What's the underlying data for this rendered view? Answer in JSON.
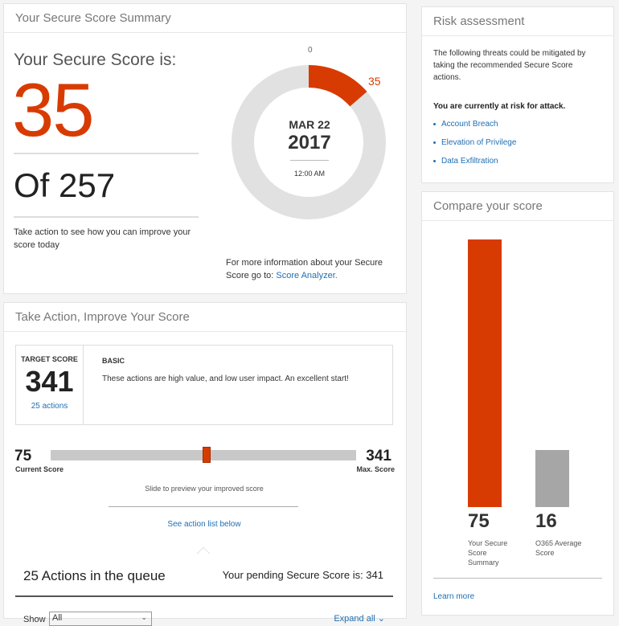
{
  "summary": {
    "title": "Your Secure Score Summary",
    "heading": "Your Secure Score is:",
    "score": "35",
    "of_text": "Of 257",
    "improve_text": "Take action to see how you can improve your score today",
    "donut": {
      "start_label": "0",
      "value_label": "35",
      "value": 35,
      "max": 257,
      "date": "MAR 22",
      "year": "2017",
      "time": "12:00 AM"
    },
    "more_info": "For more information about your Secure Score go to:",
    "score_analyzer_link": "Score Analyzer."
  },
  "risk": {
    "title": "Risk assessment",
    "intro": "The following threats could be mitigated by taking the recommended Secure Score actions.",
    "warning": "You are currently at risk for attack.",
    "threats": [
      "Account Breach",
      "Elevation of Privilege",
      "Data Exfiltration"
    ]
  },
  "compare": {
    "title": "Compare your score",
    "bars": [
      {
        "value": "75",
        "label": "Your Secure Score Summary",
        "color": "#d83b01"
      },
      {
        "value": "16",
        "label": "O365 Average Score",
        "color": "#a6a6a6"
      }
    ],
    "learn_more": "Learn more"
  },
  "action": {
    "title": "Take Action, Improve Your Score",
    "target_label": "TARGET SCORE",
    "target_value": "341",
    "target_actions": "25 actions",
    "basic_title": "BASIC",
    "basic_desc": "These actions are high value, and low user impact. An excellent start!",
    "current_value": "75",
    "current_label": "Current Score",
    "max_value": "341",
    "max_label": "Max. Score",
    "slide_hint": "Slide to preview your improved score",
    "see_action": "See action list below",
    "queue_title": "25 Actions in the queue",
    "pending": "Your pending Secure Score is: 341",
    "show_label": "Show",
    "show_value": "All",
    "expand_all": "Expand all"
  },
  "colors": {
    "accent": "#d83b01",
    "link": "#1f6fb3",
    "track": "#e1e1e1",
    "gray_bar": "#a6a6a6"
  }
}
